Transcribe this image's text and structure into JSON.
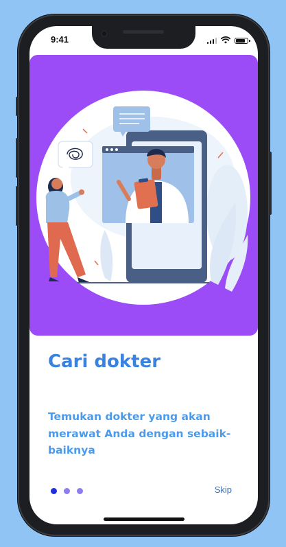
{
  "status_bar": {
    "time": "9:41",
    "battery_level": 0.85
  },
  "onboarding": {
    "title": "Cari dokter",
    "description": "Temukan dokter yang akan merawat Anda dengan sebaik-baiknya",
    "page_indicator": {
      "total": 3,
      "current": 1
    },
    "skip_label": "Skip",
    "illustration": "doctor-video-consultation-illustration"
  },
  "colors": {
    "background": "#8fc4f5",
    "hero": "#9b4cf7",
    "title": "#3a82e0",
    "description": "#4b9bea",
    "dot_active": "#1f2fe0",
    "dot_inactive": "#8c7ef0"
  }
}
